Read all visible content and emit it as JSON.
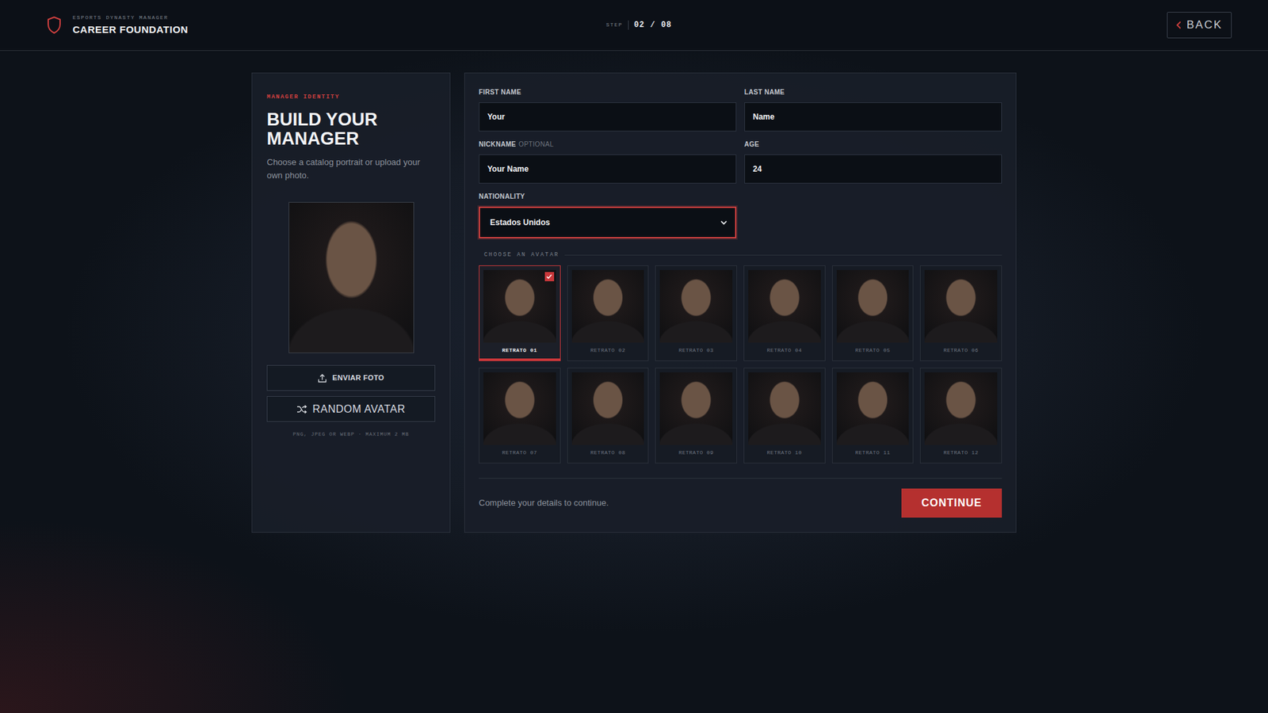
{
  "header": {
    "brand": "ESPORTS DYNASTY MANAGER",
    "title": "CAREER FOUNDATION",
    "step_label": "STEP",
    "step": "02 / 08",
    "back": "BACK"
  },
  "identity": {
    "eyebrow": "MANAGER IDENTITY",
    "title": "BUILD YOUR MANAGER",
    "description": "Choose a catalog portrait or upload your own photo.",
    "upload": "ENVIAR FOTO",
    "random": "RANDOM AVATAR",
    "hint": "PNG, JPEG OR WEBP · MAXIMUM 2 MB"
  },
  "form": {
    "fields": [
      {
        "label": "FIRST NAME",
        "value": "Your"
      },
      {
        "label": "LAST NAME",
        "value": "Name"
      },
      {
        "label": "NICKNAME",
        "optional": "OPTIONAL",
        "value": "Your Name"
      },
      {
        "label": "AGE",
        "value": "24"
      }
    ],
    "nationality": {
      "label": "NATIONALITY",
      "value": "Estados Unidos",
      "focused": true
    }
  },
  "avatars": {
    "title": "CHOOSE AN AVATAR",
    "items": [
      {
        "label": "RETRATO 01",
        "selected": true
      },
      {
        "label": "RETRATO 02",
        "selected": false
      },
      {
        "label": "RETRATO 03",
        "selected": false
      },
      {
        "label": "RETRATO 04",
        "selected": false
      },
      {
        "label": "RETRATO 05",
        "selected": false
      },
      {
        "label": "RETRATO 06",
        "selected": false
      },
      {
        "label": "RETRATO 07",
        "selected": false
      },
      {
        "label": "RETRATO 08",
        "selected": false
      },
      {
        "label": "RETRATO 09",
        "selected": false
      },
      {
        "label": "RETRATO 10",
        "selected": false
      },
      {
        "label": "RETRATO 11",
        "selected": false
      },
      {
        "label": "RETRATO 12",
        "selected": false
      }
    ]
  },
  "footer": {
    "message": "Complete your details to continue.",
    "continue": "CONTINUE"
  }
}
